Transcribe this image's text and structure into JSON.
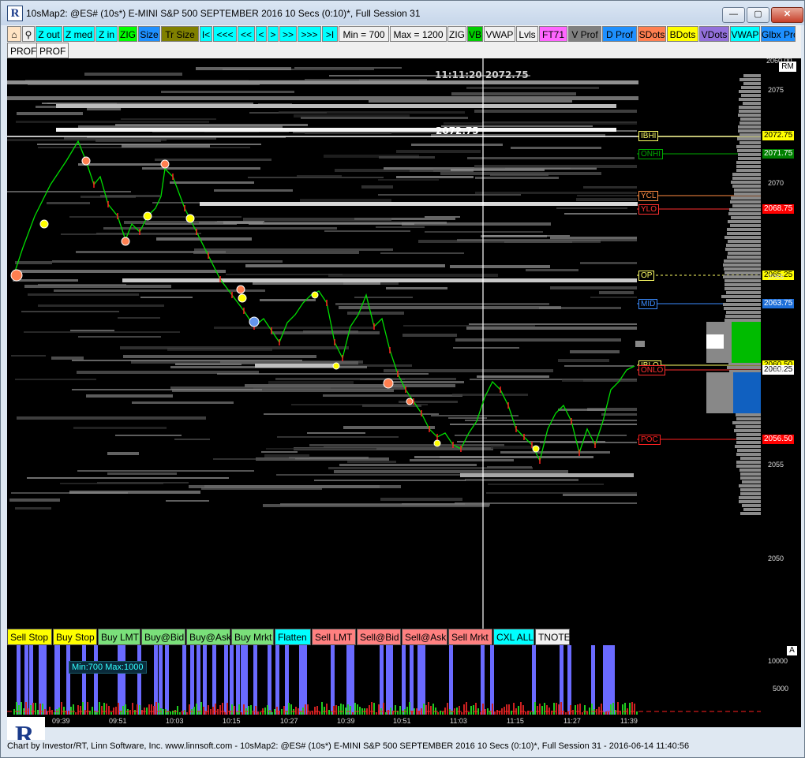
{
  "window": {
    "title": "10sMap2: @ES# (10s*) E-MINI S&P 500 SEPTEMBER 2016 10 Secs (0:10)*, Full Session 31",
    "app_logo": "R",
    "min_label": "—",
    "max_label": "▢",
    "close_label": "✕"
  },
  "toolbar": [
    {
      "label": "⌂",
      "bg": "#ffe4c4",
      "icon": "home-icon"
    },
    {
      "label": "⚲",
      "bg": "#f0f0f0",
      "icon": "tools-icon"
    },
    {
      "label": "Z out",
      "bg": "#00ffff"
    },
    {
      "label": "Z med",
      "bg": "#00ffff"
    },
    {
      "label": "Z in",
      "bg": "#00ffff"
    },
    {
      "label": "ZIG",
      "bg": "#00ff00"
    },
    {
      "label": "Size",
      "bg": "#1e90ff"
    },
    {
      "label": "Tr Size",
      "bg": "#808000"
    },
    {
      "label": "I<",
      "bg": "#00ffff"
    },
    {
      "label": "<<<",
      "bg": "#00ffff"
    },
    {
      "label": "<<",
      "bg": "#00ffff"
    },
    {
      "label": "<",
      "bg": "#00ffff"
    },
    {
      "label": ">",
      "bg": "#00ffff"
    },
    {
      "label": ">>",
      "bg": "#00ffff"
    },
    {
      "label": ">>>",
      "bg": "#00ffff"
    },
    {
      "label": ">I",
      "bg": "#00ffff"
    },
    {
      "label": "Min = 700",
      "bg": "#f0f0f0"
    },
    {
      "label": "Max = 1200",
      "bg": "#f0f0f0"
    },
    {
      "label": "ZIG",
      "bg": "#f0f0f0"
    },
    {
      "label": "VB",
      "bg": "#00cc00"
    },
    {
      "label": "VWAP",
      "bg": "#f0f0f0"
    },
    {
      "label": "Lvls",
      "bg": "#f0f0f0"
    },
    {
      "label": "FT71",
      "bg": "#ff66ff"
    },
    {
      "label": "V Prof",
      "bg": "#808080"
    },
    {
      "label": "D Prof",
      "bg": "#1e90ff"
    },
    {
      "label": "SDots",
      "bg": "#ff7f50"
    },
    {
      "label": "BDots",
      "bg": "#ffff00"
    },
    {
      "label": "VDots",
      "bg": "#9370db"
    },
    {
      "label": "VWAP",
      "bg": "#00ffff"
    },
    {
      "label": "Glbx Pro",
      "bg": "#1e90ff"
    }
  ],
  "tabs": [
    "PROF",
    "PROF"
  ],
  "chart": {
    "cursor_time": "11:11:20",
    "cursor_price": "2072.75",
    "crosshair_price": "2072.75",
    "rm_label": "RM",
    "price_ticks": [
      "2060.00",
      "2075",
      "2070",
      "2065",
      "2060",
      "2055",
      "2050"
    ],
    "time_ticks": [
      "09:39",
      "09:51",
      "10:03",
      "10:15",
      "10:27",
      "10:39",
      "10:51",
      "11:03",
      "11:15",
      "11:27",
      "11:39"
    ],
    "levels": [
      {
        "name": "ONHI",
        "color": "#00aa00",
        "price": "2071.75",
        "price_bg": "#008000",
        "price_fg": "#ffffff"
      },
      {
        "name": "YCL",
        "color": "#ff8c42",
        "price": "",
        "price_bg": "",
        "price_fg": ""
      },
      {
        "name": "YLO",
        "color": "#ff3030",
        "price": "2068.75",
        "price_bg": "#ff0000",
        "price_fg": "#ffffff"
      },
      {
        "name": "OP",
        "color": "#ffff66",
        "price": "2065.25",
        "price_bg": "#ffff00",
        "price_fg": "#000000"
      },
      {
        "name": "MID",
        "color": "#3c8cff",
        "price": "2063.75",
        "price_bg": "#1e6fd9",
        "price_fg": "#ffffff"
      },
      {
        "name": "IBLO",
        "color": "#ffff66",
        "price": "2060.50",
        "price_bg": "#ffff00",
        "price_fg": "#000000"
      },
      {
        "name": "ONLO",
        "color": "#ff3030",
        "price": "2060.25",
        "price_bg": "#ffffff",
        "price_fg": "#000000"
      },
      {
        "name": "POC",
        "color": "#ff2020",
        "price": "2056.50",
        "price_bg": "#ff0000",
        "price_fg": "#ffffff"
      }
    ],
    "top_level_price": "2072.75",
    "top_level_name": "IBHI"
  },
  "trade_buttons": [
    {
      "label": "Sell Stop",
      "bg": "#ffff00"
    },
    {
      "label": "Buy Stop",
      "bg": "#ffff00"
    },
    {
      "label": "Buy LMT",
      "bg": "#7ae07a"
    },
    {
      "label": "Buy@Bid",
      "bg": "#7ae07a"
    },
    {
      "label": "Buy@Ask",
      "bg": "#7ae07a"
    },
    {
      "label": "Buy Mrkt",
      "bg": "#7ae07a"
    },
    {
      "label": "Flatten",
      "bg": "#00ffff"
    },
    {
      "label": "Sell LMT",
      "bg": "#ff8080"
    },
    {
      "label": "Sell@Bid",
      "bg": "#ff8080"
    },
    {
      "label": "Sell@Ask",
      "bg": "#ff8080"
    },
    {
      "label": "Sell Mrkt",
      "bg": "#ff8080"
    },
    {
      "label": "CXL ALL",
      "bg": "#00ffff"
    },
    {
      "label": "TNOTE",
      "bg": "#f0f0f0"
    }
  ],
  "volume": {
    "label": "Min:700 Max:1000",
    "a_label": "A",
    "ticks": [
      "10000",
      "5000"
    ]
  },
  "footer": "Chart by Investor/RT, Linn Software, Inc. www.linnsoft.com - 10sMap2: @ES# (10s*) E-MINI S&P 500 SEPTEMBER 2016 10 Secs (0:10)*, Full Session 31 - 2016-06-14 11:40:56",
  "colors": {
    "up": "#00cc00",
    "down": "#ff2020",
    "heat": "#ffffff"
  }
}
